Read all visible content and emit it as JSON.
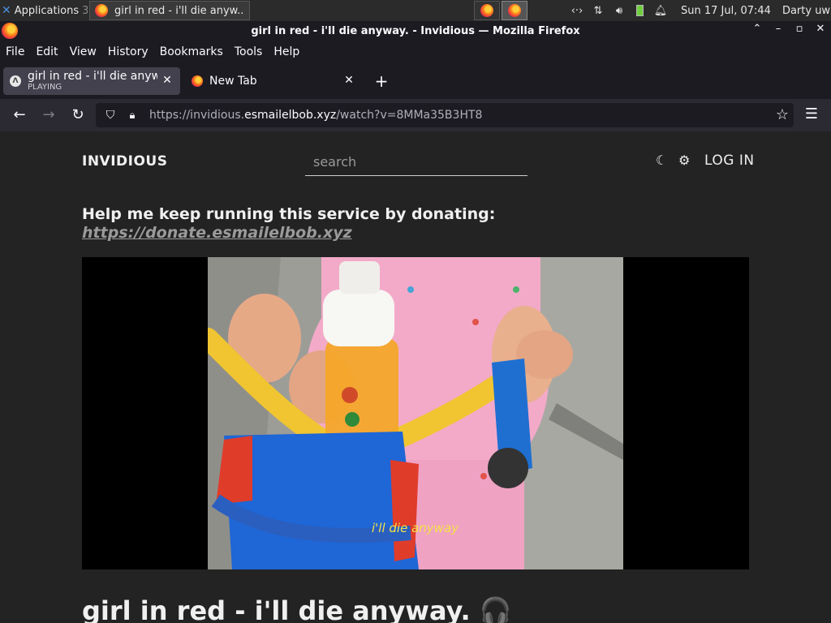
{
  "taskbar": {
    "apps_label": "Applications",
    "apps_suffix": "3",
    "task_title": "girl in red - i'll die anyw...",
    "tray": {
      "network_icon": "network-icon",
      "transfer_icon": "transfer-arrows-icon",
      "volume_icon": "volume-icon",
      "battery_icon": "battery-icon",
      "bell_icon": "bell-icon"
    },
    "clock": "Sun 17 Jul, 07:44",
    "user": "Darty uwu"
  },
  "window": {
    "title": "girl in red - i'll die anyway. - Invidious — Mozilla Firefox"
  },
  "menubar": {
    "items": [
      "File",
      "Edit",
      "View",
      "History",
      "Bookmarks",
      "Tools",
      "Help"
    ]
  },
  "tabs": [
    {
      "title": "girl in red - i'll die anyway",
      "status": "PLAYING",
      "active": true
    },
    {
      "title": "New Tab",
      "active": false
    }
  ],
  "navbar": {
    "url_prefix": "https://invidious.",
    "url_host": "esmailelbob.xyz",
    "url_path": "/watch?v=8MMa35B3HT8"
  },
  "page": {
    "brand": "INVIDIOUS",
    "search_placeholder": "search",
    "login": "LOG IN",
    "donate_text": "Help me keep running this service by donating:",
    "donate_link": "https://donate.esmailelbob.xyz",
    "video_subtitle": "i'll die anyway",
    "video_title": "girl in red - i'll die anyway.",
    "title_icon": "🎧"
  },
  "colors": {
    "page_bg": "#232323",
    "browser_chrome": "#1c1b22",
    "subtitle_yellow": "#f2e14a"
  }
}
